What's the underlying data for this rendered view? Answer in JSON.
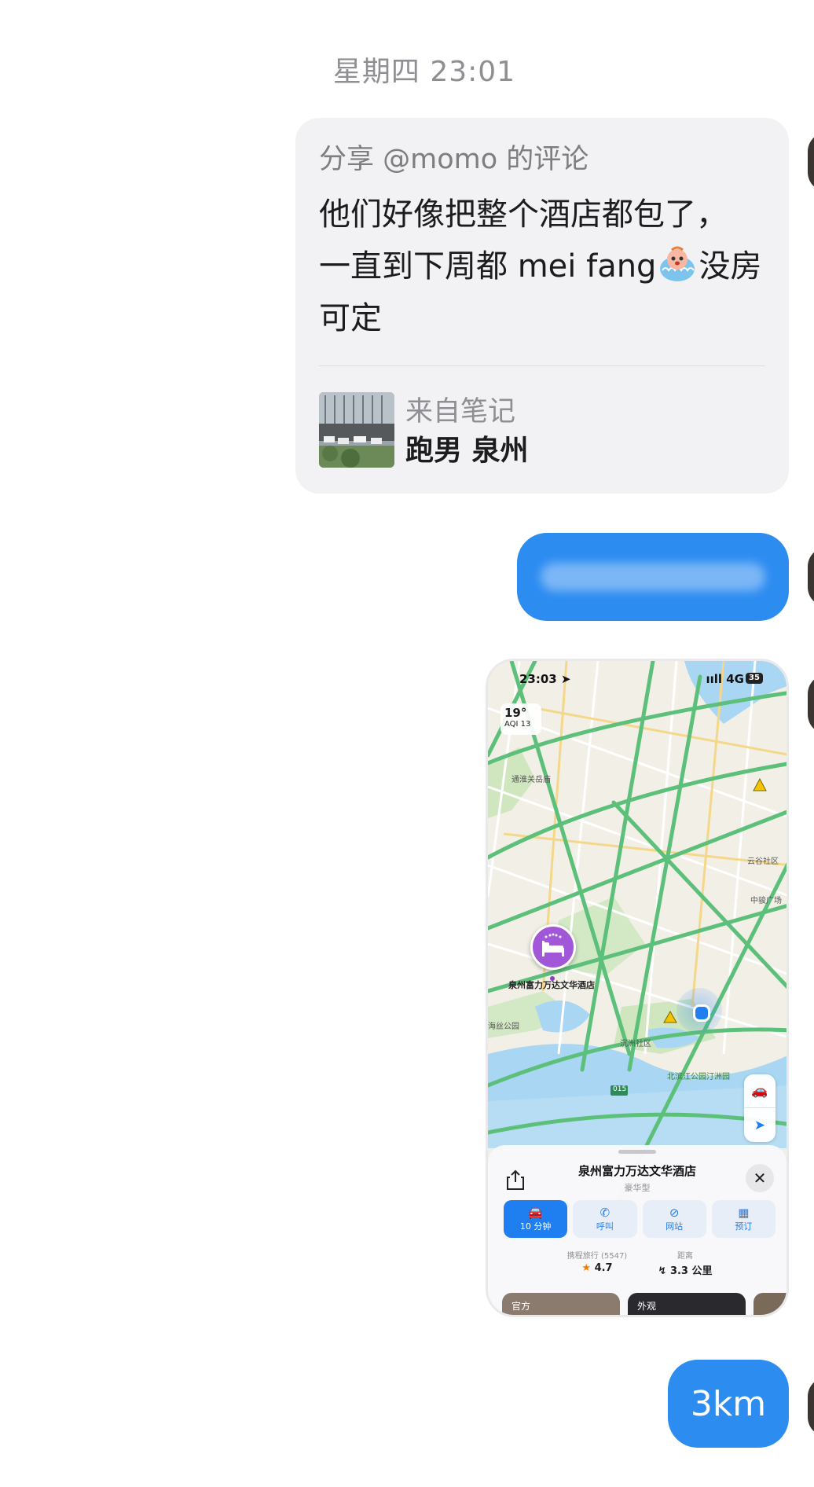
{
  "timestamp": "星期四 23:01",
  "share_card": {
    "header": "分享 @momo 的评论",
    "body_line1": "他们好像把整个酒店都包了，",
    "body_line2_a": "一直到下周都 mei fang",
    "body_line2_b": "没房",
    "body_line3": "可定",
    "note_from": "来自笔记",
    "note_title": "跑男 泉州"
  },
  "map_screenshot": {
    "status_time": "23:03 ➤",
    "status_network": "ııll 4G",
    "battery": "35",
    "weather_temp": "19°",
    "weather_aqi": "AQI 13",
    "labels": {
      "area_1": "通淮关岳庙",
      "area_2": "云谷社区",
      "area_3": "中骏广场",
      "area_4": "沉洲社区",
      "area_5": "北滨江公园汀洲园",
      "area_6": "海丝公园",
      "road_sign": "015"
    },
    "hotel_label": "泉州富力万达文华酒店",
    "sheet": {
      "title": "泉州富力万达文华酒店",
      "subtitle": "豪华型",
      "actions": [
        {
          "icon": "car-icon",
          "label": "10 分钟"
        },
        {
          "icon": "phone-icon",
          "label": "呼叫"
        },
        {
          "icon": "compass-icon",
          "label": "网站"
        },
        {
          "icon": "calendar-icon",
          "label": "预订"
        }
      ],
      "rating_source": "携程旅行 (5547)",
      "rating_value": "4.7",
      "distance_label": "距离",
      "distance_value": "3.3 公里",
      "photo_tab_1": "官方",
      "photo_tab_2": "外观"
    }
  },
  "reply_km": "3km",
  "colors": {
    "bubble_blue": "#2d8cf0",
    "card_gray": "#f2f2f4",
    "hotel_purple": "#a256d8"
  }
}
